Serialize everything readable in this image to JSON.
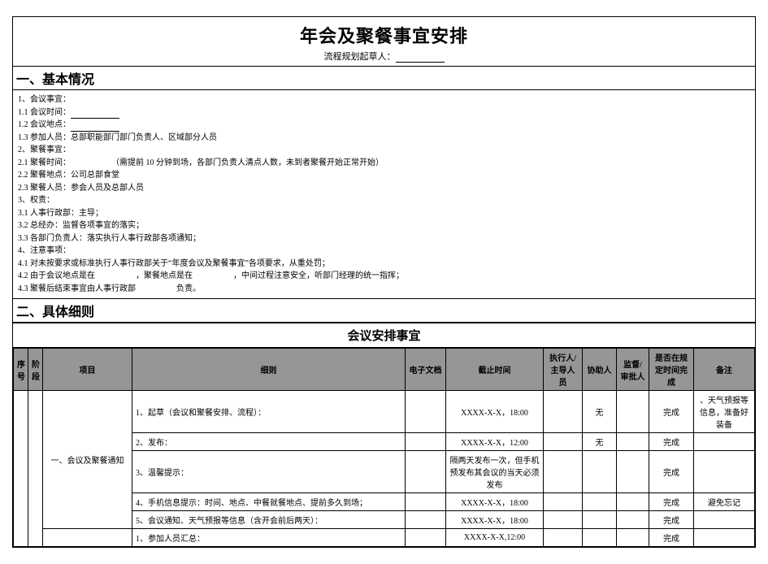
{
  "header": {
    "main_title": "年会及聚餐事宜安排",
    "subtitle_label": "流程规划起草人："
  },
  "section1": {
    "title": "一、基本情况",
    "lines": [
      "1、会议事宜：",
      "1.1 会议时间：",
      "1.2 会议地点：",
      "1.3 参加人员：总部职能部门部门负责人、区域部分人员",
      "2、聚餐事宜：",
      "2.1 聚餐时间：　　　　　　（需提前 10 分钟到场，各部门负责人清点人数，未到者聚餐开始正常开始）",
      "2.2 聚餐地点：公司总部食堂",
      "2.3 聚餐人员：参会人员及总部人员",
      "3、权责：",
      "3.1 人事行政部：主导；",
      "3.2 总经办：监督各项事宜的落实；",
      "3.3 各部门负责人：落实执行人事行政部各项通知；",
      "4、注意事项：",
      "4.1 对未按要求或标准执行人事行政部关于“年度会议及聚餐事宜”各项要求，从重处罚；",
      "4.2 由于会议地点是在　　　　　，聚餐地点是在　　　　　，中间过程注意安全，听部门经理的统一指挥；",
      "4.3 聚餐后结束事宜由人事行政部　　　　　负责。"
    ]
  },
  "section2": {
    "title": "二、具体细则",
    "sub_title": "会议安排事宜"
  },
  "table": {
    "headers": {
      "seq": "序号",
      "phase": "阶段",
      "item": "项目",
      "detail": "细则",
      "edoc": "电子文档",
      "deadline": "截止时间",
      "executor": "执行人/主导人员",
      "assist": "协助人",
      "supervise": "监督/审批人",
      "done": "是否在规定时间完成",
      "note": "备注"
    },
    "group_label": "一、会议及聚餐通知",
    "rows": [
      {
        "detail": "1、起草（会议和聚餐安排、流程）：",
        "deadline": "XXXX-X-X，18:00",
        "assist": "无",
        "done": "完成",
        "note": "、天气预报等信息，准备好装备"
      },
      {
        "detail": "2、发布：",
        "deadline": "XXXX-X-X，12:00",
        "assist": "无",
        "done": "完成",
        "note": ""
      },
      {
        "detail": "3、温馨提示：",
        "deadline": "隔两天发布一次，但手机预发布其会议的当天必须发布",
        "assist": "",
        "done": "完成",
        "note": ""
      },
      {
        "detail": "4、手机信息提示：时间、地点、中餐就餐地点、提前多久到场；",
        "deadline": "XXXX-X-X，18:00",
        "assist": "",
        "done": "完成",
        "note": "避免忘记"
      },
      {
        "detail": "5、会议通知、天气预报等信息（含开会前后两天）：",
        "deadline": "XXXX-X-X，18:00",
        "assist": "",
        "done": "完成",
        "note": ""
      },
      {
        "detail": "1、参加人员汇总：",
        "deadline": "XXXX-X-X,12:00",
        "assist": "",
        "done": "完成",
        "note": ""
      }
    ]
  }
}
